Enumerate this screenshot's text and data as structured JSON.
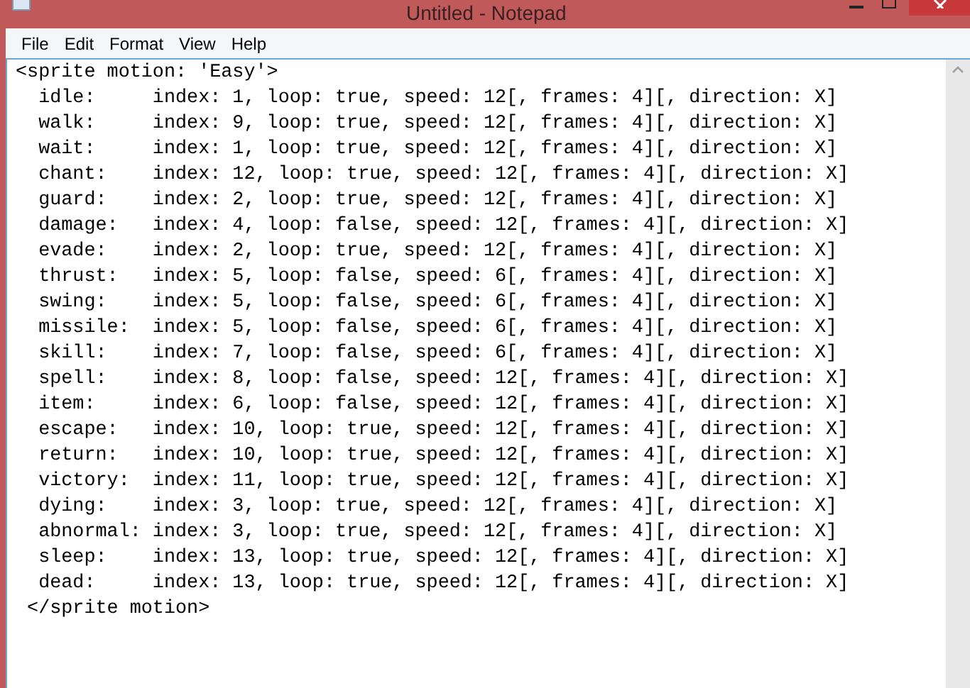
{
  "window": {
    "title": "Untitled - Notepad"
  },
  "menu": [
    "File",
    "Edit",
    "Format",
    "View",
    "Help"
  ],
  "document": {
    "lines": [
      "<sprite motion: 'Easy'>",
      "  idle:     index: 1, loop: true, speed: 12[, frames: 4][, direction: X]",
      "  walk:     index: 9, loop: true, speed: 12[, frames: 4][, direction: X]",
      "  wait:     index: 1, loop: true, speed: 12[, frames: 4][, direction: X]",
      "  chant:    index: 12, loop: true, speed: 12[, frames: 4][, direction: X]",
      "  guard:    index: 2, loop: true, speed: 12[, frames: 4][, direction: X]",
      "  damage:   index: 4, loop: false, speed: 12[, frames: 4][, direction: X]",
      "  evade:    index: 2, loop: true, speed: 12[, frames: 4][, direction: X]",
      "  thrust:   index: 5, loop: false, speed: 6[, frames: 4][, direction: X]",
      "  swing:    index: 5, loop: false, speed: 6[, frames: 4][, direction: X]",
      "  missile:  index: 5, loop: false, speed: 6[, frames: 4][, direction: X]",
      "  skill:    index: 7, loop: false, speed: 6[, frames: 4][, direction: X]",
      "  spell:    index: 8, loop: false, speed: 12[, frames: 4][, direction: X]",
      "  item:     index: 6, loop: false, speed: 12[, frames: 4][, direction: X]",
      "  escape:   index: 10, loop: true, speed: 12[, frames: 4][, direction: X]",
      "  return:   index: 10, loop: true, speed: 12[, frames: 4][, direction: X]",
      "  victory:  index: 11, loop: true, speed: 12[, frames: 4][, direction: X]",
      "  dying:    index: 3, loop: true, speed: 12[, frames: 4][, direction: X]",
      "  abnormal: index: 3, loop: true, speed: 12[, frames: 4][, direction: X]",
      "  sleep:    index: 13, loop: true, speed: 12[, frames: 4][, direction: X]",
      "  dead:     index: 13, loop: true, speed: 12[, frames: 4][, direction: X]",
      " </sprite motion>"
    ]
  }
}
